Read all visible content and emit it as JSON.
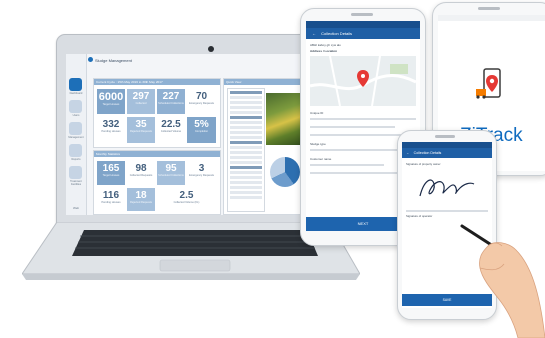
{
  "laptop": {
    "brand": "Sludge Management",
    "sidebar": [
      {
        "label": "Dashboard",
        "icon": "dashboard-icon",
        "active": true
      },
      {
        "label": "Users",
        "icon": "users-icon",
        "active": false
      },
      {
        "label": "Management",
        "icon": "management-icon",
        "active": false
      },
      {
        "label": "Reports",
        "icon": "reports-icon",
        "active": false
      },
      {
        "label": "Treatment Facilities",
        "icon": "facility-icon",
        "active": false
      }
    ],
    "current_panel": {
      "title": "Current Cycle : 15th May 2016 to 30th May 2017",
      "tiles": [
        {
          "value": "6000",
          "label": "Target Houses"
        },
        {
          "value": "297",
          "label": "Collected"
        },
        {
          "value": "227",
          "label": "Scheduled Collections"
        },
        {
          "value": "70",
          "label": "Emergency Requests"
        },
        {
          "value": "332",
          "label": "Pending Houses"
        },
        {
          "value": "35",
          "label": "Rejected Requests"
        },
        {
          "value": "22.5",
          "label": "Collected Volume"
        },
        {
          "value": "5%",
          "label": "Completion"
        }
      ]
    },
    "monthly_panel": {
      "title": "Monthly Statistics",
      "tiles": [
        {
          "value": "165",
          "label": "Target Houses"
        },
        {
          "value": "98",
          "label": "Collected Requests"
        },
        {
          "value": "95",
          "label": "Scheduled Collections"
        },
        {
          "value": "3",
          "label": "Emergency Requests"
        },
        {
          "value": "116",
          "label": "Pending Houses"
        },
        {
          "value": "18",
          "label": "Rejected Requests"
        },
        {
          "value": "2.5",
          "label": "Collected Volume (KL)"
        }
      ]
    },
    "right_panel": {
      "title": "Quick View"
    },
    "footer": "Web"
  },
  "phone_main": {
    "title": "Collection Details",
    "address": "ABHI kaboy gh xyw alo",
    "place_heading": "Address / Location",
    "fields": [
      "Unique ID",
      "Sludge type",
      "Customer name"
    ],
    "next_label": "NEXT"
  },
  "phone_splash": {
    "app_name": "ZiTrack"
  },
  "phone_signature": {
    "title": "Collection Details",
    "sig1_label": "Signature of property owner",
    "sig2_label": "Signature of operator",
    "save_label": "SAVE"
  }
}
